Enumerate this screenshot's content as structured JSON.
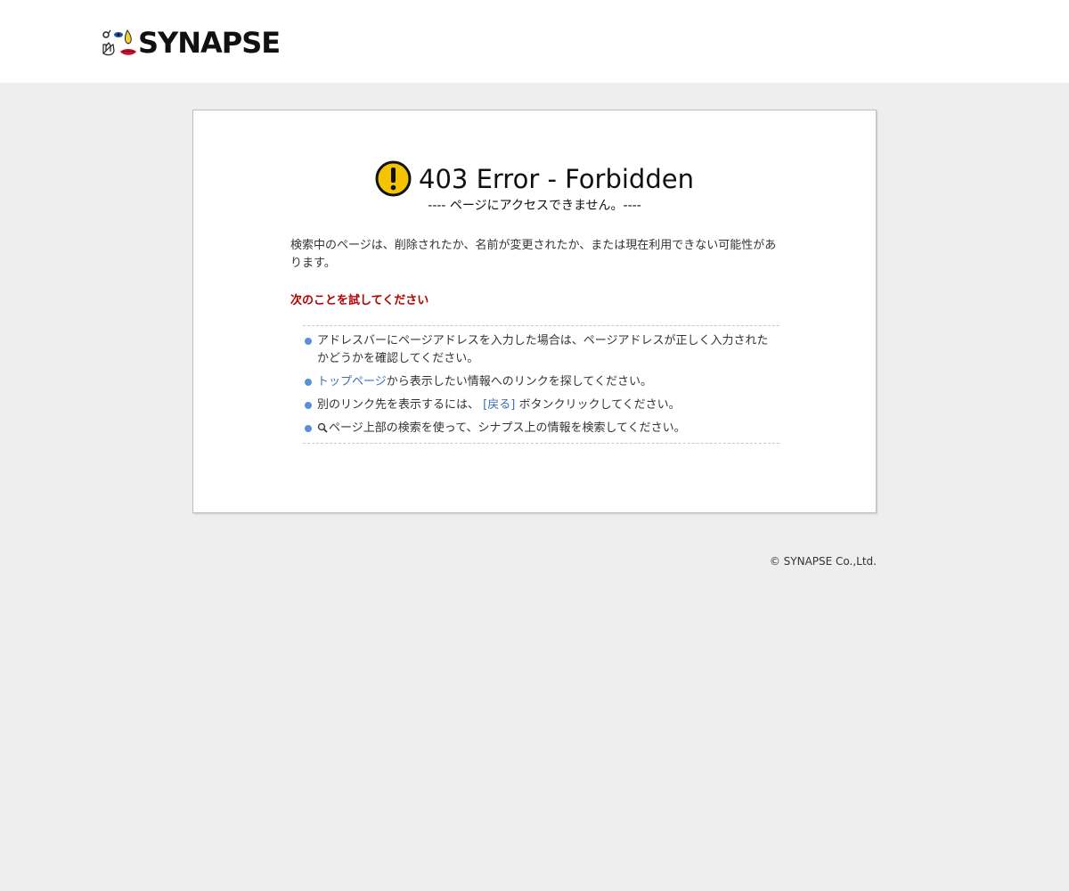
{
  "header": {
    "logo_text": "SYNAPSE"
  },
  "error": {
    "title": "403 Error - Forbidden",
    "subtitle": "---- ページにアクセスできません。----",
    "message": "検索中のページは、削除されたか、名前が変更されたか、または現在利用できない可能性があります。",
    "try_heading": "次のことを試してください"
  },
  "suggestions": {
    "item1": "アドレスバーにページアドレスを入力した場合は、ページアドレスが正しく入力されたかどうかを確認してください。",
    "item2_link": "トップページ",
    "item2_text": "から表示したい情報へのリンクを探してください。",
    "item3_pre": "別のリンク先を表示するには、",
    "item3_link": "[戻る]",
    "item3_post": "ボタンクリックしてください。",
    "item4_text": "ページ上部の検索を使って、シナプス上の情報を検索してください。"
  },
  "footer": {
    "copyright": "© SYNAPSE Co.,Ltd."
  },
  "colors": {
    "page_background": "#eeeeee",
    "heading_red": "#b40000",
    "link_blue": "#3d6fb6",
    "bullet_blue": "#5b8fd9",
    "warning_yellow": "#f5c400"
  },
  "icons": {
    "logo": "synapse-logo-mark",
    "error": "exclamation-circle-icon",
    "bullet": "blue-dot-bullet",
    "search": "magnifier-icon"
  }
}
